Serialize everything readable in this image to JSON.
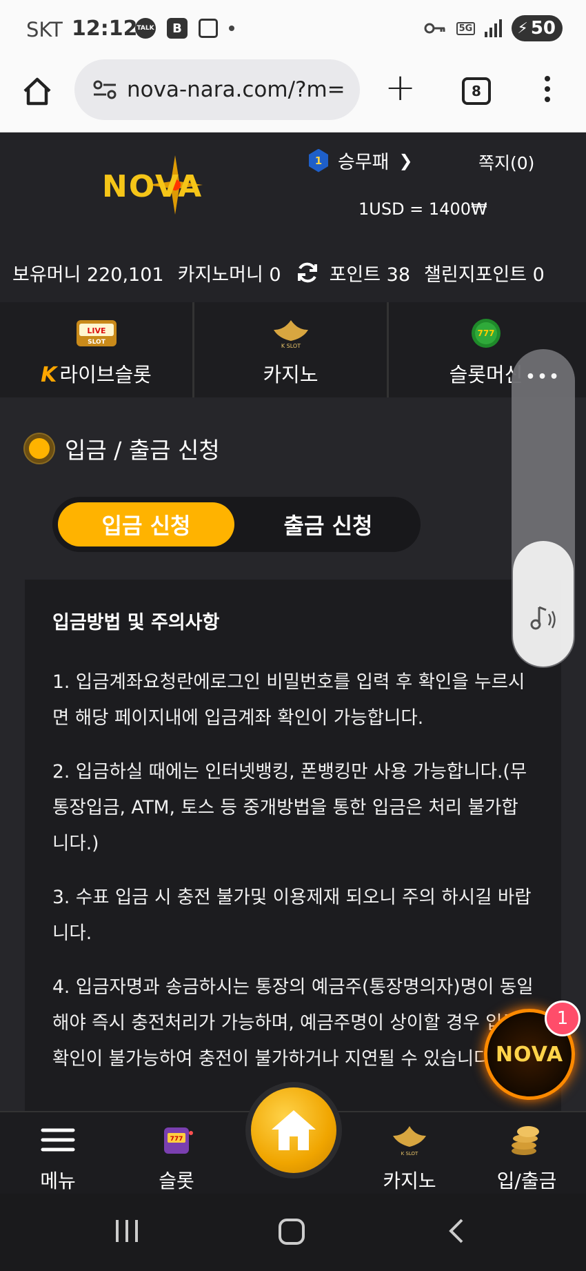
{
  "status_bar": {
    "carrier": "SKT",
    "time": "12:12",
    "battery": "50",
    "network": "5G"
  },
  "browser": {
    "url": "nova-nara.com/?m=",
    "tab_count": "8"
  },
  "header": {
    "logo_text": "NOVA",
    "rank_level": "1",
    "user_name": "승무패",
    "memo": "쪽지(0)",
    "exchange_rate": "1USD = 1400₩",
    "balances": {
      "money": "보유머니 220,101",
      "casino_money": "카지노머니 0",
      "points": "포인트 38",
      "challenge_points": "챌린지포인트 0"
    }
  },
  "categories": [
    {
      "label": "라이브슬롯",
      "mark": "K",
      "icon": "live-slot-icon"
    },
    {
      "label": "카지노",
      "icon": "k-slot-casino-icon"
    },
    {
      "label": "슬롯머신",
      "icon": "777-slots-icon"
    }
  ],
  "section": {
    "title": "입금 / 출금 신청",
    "tab_deposit": "입금 신청",
    "tab_withdraw": "출금 신청"
  },
  "notice": {
    "heading": "입금방법 및 주의사항",
    "items": [
      "1. 입금계좌요청란에로그인 비밀번호를 입력 후 확인을 누르시면 해당 페이지내에 입금계좌 확인이 가능합니다.",
      "2. 입금하실 때에는 인터넷뱅킹, 폰뱅킹만 사용 가능합니다.(무통장입금, ATM, 토스 등 중개방법을 통한 입금은 처리 불가합니다.)",
      "3. 수표 입금 시 충전 불가및 이용제재 되오니 주의 하시길 바랍니다.",
      "4. 입금자명과 송금하시는 통장의 예금주(통장명의자)명이 동일해야 즉시 충전처리가 가능하며, 예금주명이 상이할 경우 입금 확인이 불가능하여 충전이 불가하거나 지연될 수 있습니다."
    ]
  },
  "fab": {
    "text": "NOVA",
    "badge": "1"
  },
  "bottom_nav": {
    "menu": "메뉴",
    "slot": "슬롯",
    "casino": "카지노",
    "deposit": "입/출금"
  },
  "colors": {
    "accent": "#ffb300",
    "background": "#26262a",
    "badge": "#ff4d6a"
  }
}
